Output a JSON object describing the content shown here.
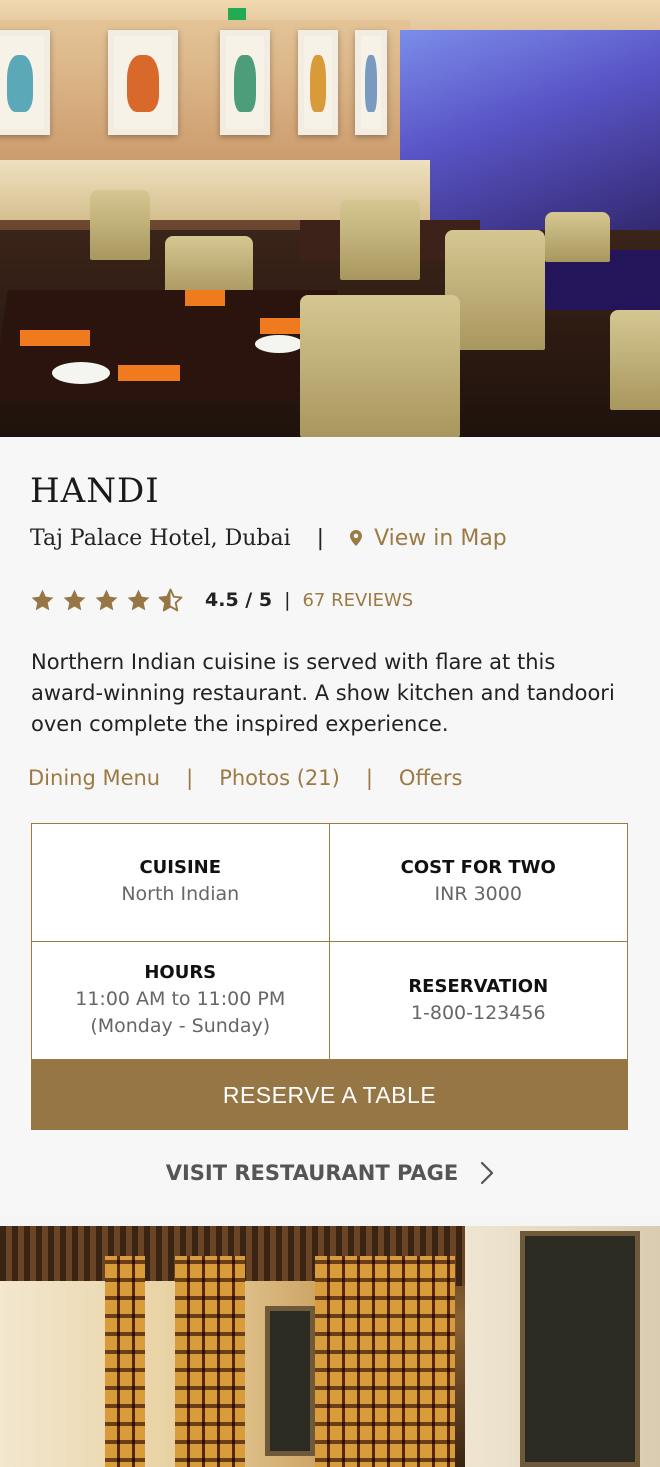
{
  "restaurant": {
    "name": "HANDI",
    "location": "Taj Palace Hotel, Dubai",
    "location_separator": "|",
    "map_link_label": "View in Map",
    "rating": {
      "stars_value": 4.5,
      "stars_max": 5,
      "value_text": "4.5 / 5",
      "separator": "|",
      "reviews_label": "67 REVIEWS"
    },
    "description": "Northern Indian cuisine is served with flare at this award-winning restaurant. A show kitchen and tandoori oven complete the inspired experience."
  },
  "links": {
    "dining_menu": "Dining Menu",
    "photos": "Photos (21)",
    "offers": "Offers",
    "separator": "|"
  },
  "info": {
    "cuisine_label": "CUISINE",
    "cuisine_value": "North Indian",
    "cost_label": "COST FOR TWO",
    "cost_value": "INR 3000",
    "hours_label": "HOURS",
    "hours_value": "11:00 AM to 11:00 PM",
    "hours_days": "(Monday - Sunday)",
    "reservation_label": "RESERVATION",
    "reservation_value": "1-800-123456"
  },
  "actions": {
    "reserve_label": "RESERVE A TABLE",
    "visit_label": "VISIT RESTAURANT PAGE"
  },
  "colors": {
    "accent": "#977645",
    "link": "#9c7a44",
    "star": "#977645"
  },
  "icons": {
    "map_pin": "map-pin-icon",
    "star": "star-icon",
    "visit_chevron": "chevron-right-icon"
  }
}
